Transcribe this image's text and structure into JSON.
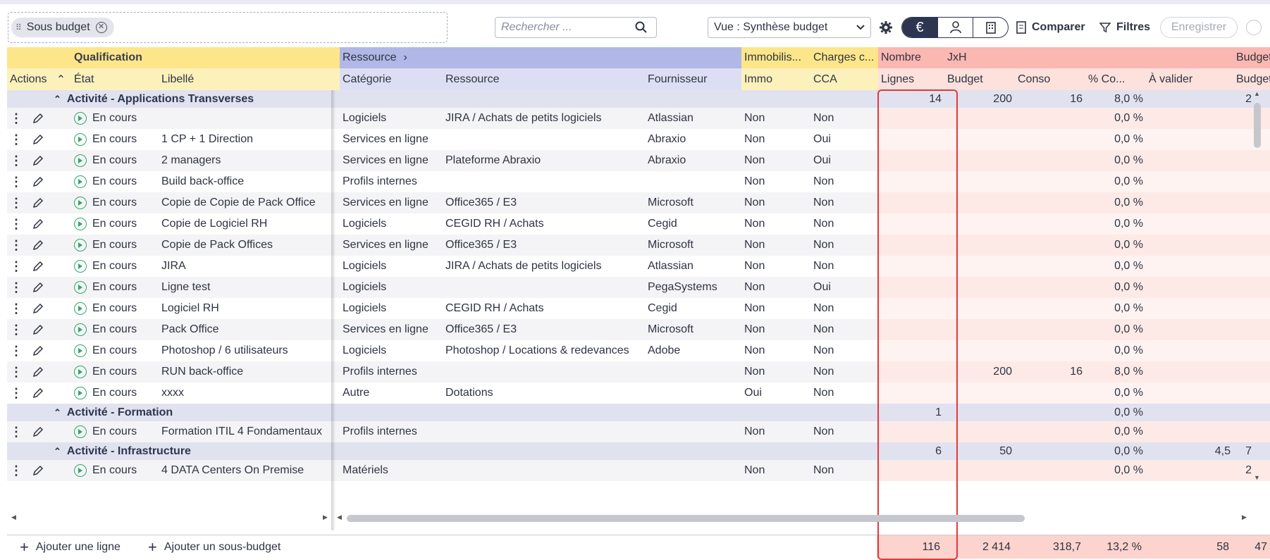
{
  "toolbar": {
    "chip_label": "Sous budget",
    "search_placeholder": "Rechercher ...",
    "view_select": "Vue : Synthèse budget",
    "compare_label": "Comparer",
    "filters_label": "Filtres",
    "save_label": "Enregistrer"
  },
  "header": {
    "group_qualification": "Qualification",
    "group_ressource": "Ressource",
    "group_immobilis": "Immobilis...",
    "group_charges": "Charges c...",
    "group_nombre": "Nombre",
    "group_jxh": "JxH",
    "group_budget": "Budget",
    "col_actions": "Actions",
    "col_etat": "État",
    "col_libelle": "Libellé",
    "col_categorie": "Catégorie",
    "col_ressource": "Ressource",
    "col_fournisseur": "Fournisseur",
    "col_immo": "Immo",
    "col_cca": "CCA",
    "col_lignes": "Lignes",
    "col_budget": "Budget",
    "col_conso": "Conso",
    "col_pct": "% Co...",
    "col_avalider": "À valider",
    "col_budget2": "Budget"
  },
  "groups": [
    {
      "label": "Activité - Applications Transverses",
      "lignes": "14",
      "budget": "200",
      "conso": "16",
      "pct": "8,0 %",
      "avalider": "",
      "budget2": "2"
    },
    {
      "label": "Activité - Formation",
      "lignes": "1",
      "budget": "",
      "conso": "",
      "pct": "0,0 %",
      "avalider": "",
      "budget2": ""
    },
    {
      "label": "Activité - Infrastructure",
      "lignes": "6",
      "budget": "50",
      "conso": "",
      "pct": "0,0 %",
      "avalider": "4,5",
      "budget2": "7"
    }
  ],
  "rows_group1": [
    {
      "etat": "En cours",
      "libelle": "",
      "categorie": "Logiciels",
      "ressource": "JIRA / Achats de petits logiciels",
      "fournisseur": "Atlassian",
      "immo": "Non",
      "cca": "Non",
      "budget": "",
      "conso": "",
      "pct": "0,0 %"
    },
    {
      "etat": "En cours",
      "libelle": "1 CP + 1 Direction",
      "categorie": "Services en ligne",
      "ressource": "",
      "fournisseur": "Abraxio",
      "immo": "Non",
      "cca": "Oui",
      "budget": "",
      "conso": "",
      "pct": "0,0 %"
    },
    {
      "etat": "En cours",
      "libelle": "2 managers",
      "categorie": "Services en ligne",
      "ressource": "Plateforme Abraxio",
      "fournisseur": "Abraxio",
      "immo": "Non",
      "cca": "Oui",
      "budget": "",
      "conso": "",
      "pct": "0,0 %"
    },
    {
      "etat": "En cours",
      "libelle": "Build back-office",
      "categorie": "Profils internes",
      "ressource": "",
      "fournisseur": "",
      "immo": "Non",
      "cca": "Non",
      "budget": "",
      "conso": "",
      "pct": "0,0 %"
    },
    {
      "etat": "En cours",
      "libelle": "Copie de Copie de Pack Office",
      "categorie": "Services en ligne",
      "ressource": "Office365 / E3",
      "fournisseur": "Microsoft",
      "immo": "Non",
      "cca": "Non",
      "budget": "",
      "conso": "",
      "pct": "0,0 %"
    },
    {
      "etat": "En cours",
      "libelle": "Copie de Logiciel RH",
      "categorie": "Logiciels",
      "ressource": "CEGID RH / Achats",
      "fournisseur": "Cegid",
      "immo": "Non",
      "cca": "Non",
      "budget": "",
      "conso": "",
      "pct": "0,0 %"
    },
    {
      "etat": "En cours",
      "libelle": "Copie de Pack Offices",
      "categorie": "Services en ligne",
      "ressource": "Office365 / E3",
      "fournisseur": "Microsoft",
      "immo": "Non",
      "cca": "Non",
      "budget": "",
      "conso": "",
      "pct": "0,0 %"
    },
    {
      "etat": "En cours",
      "libelle": "JIRA",
      "categorie": "Logiciels",
      "ressource": "JIRA / Achats de petits logiciels",
      "fournisseur": "Atlassian",
      "immo": "Non",
      "cca": "Non",
      "budget": "",
      "conso": "",
      "pct": "0,0 %"
    },
    {
      "etat": "En cours",
      "libelle": "Ligne test",
      "categorie": "Logiciels",
      "ressource": "",
      "fournisseur": "PegaSystems",
      "immo": "Non",
      "cca": "Oui",
      "budget": "",
      "conso": "",
      "pct": "0,0 %"
    },
    {
      "etat": "En cours",
      "libelle": "Logiciel RH",
      "categorie": "Logiciels",
      "ressource": "CEGID RH / Achats",
      "fournisseur": "Cegid",
      "immo": "Non",
      "cca": "Non",
      "budget": "",
      "conso": "",
      "pct": "0,0 %"
    },
    {
      "etat": "En cours",
      "libelle": "Pack Office",
      "categorie": "Services en ligne",
      "ressource": "Office365 / E3",
      "fournisseur": "Microsoft",
      "immo": "Non",
      "cca": "Non",
      "budget": "",
      "conso": "",
      "pct": "0,0 %"
    },
    {
      "etat": "En cours",
      "libelle": "Photoshop / 6 utilisateurs",
      "categorie": "Logiciels",
      "ressource": "Photoshop / Locations & redevances",
      "fournisseur": "Adobe",
      "immo": "Non",
      "cca": "Non",
      "budget": "",
      "conso": "",
      "pct": "0,0 %"
    },
    {
      "etat": "En cours",
      "libelle": "RUN back-office",
      "categorie": "Profils internes",
      "ressource": "",
      "fournisseur": "",
      "immo": "Non",
      "cca": "Non",
      "budget": "200",
      "conso": "16",
      "pct": "8,0 %"
    },
    {
      "etat": "En cours",
      "libelle": "xxxx",
      "categorie": "Autre",
      "ressource": "Dotations",
      "fournisseur": "",
      "immo": "Oui",
      "cca": "Non",
      "budget": "",
      "conso": "",
      "pct": "0,0 %"
    }
  ],
  "rows_group2": [
    {
      "etat": "En cours",
      "libelle": "Formation ITIL 4 Fondamentaux",
      "categorie": "Profils internes",
      "ressource": "",
      "fournisseur": "",
      "immo": "Non",
      "cca": "Non",
      "budget": "",
      "conso": "",
      "pct": "0,0 %"
    }
  ],
  "rows_group3": [
    {
      "etat": "En cours",
      "libelle": "4 DATA Centers On Premise",
      "categorie": "Matériels",
      "ressource": "",
      "fournisseur": "",
      "immo": "Non",
      "cca": "Non",
      "budget": "",
      "conso": "",
      "pct": "0,0 %",
      "budget2": "2"
    }
  ],
  "footer": {
    "add_line": "Ajouter une ligne",
    "add_subbudget": "Ajouter un sous-budget",
    "tot_lignes": "116",
    "tot_budget": "2 414",
    "tot_conso": "318,7",
    "tot_pct": "13,2 %",
    "tot_avalider": "58",
    "tot_budget2": "47"
  },
  "colors": {
    "accent_dark": "#2d3550",
    "status_green": "#2fa96b",
    "highlight_red": "#e03a3a"
  }
}
